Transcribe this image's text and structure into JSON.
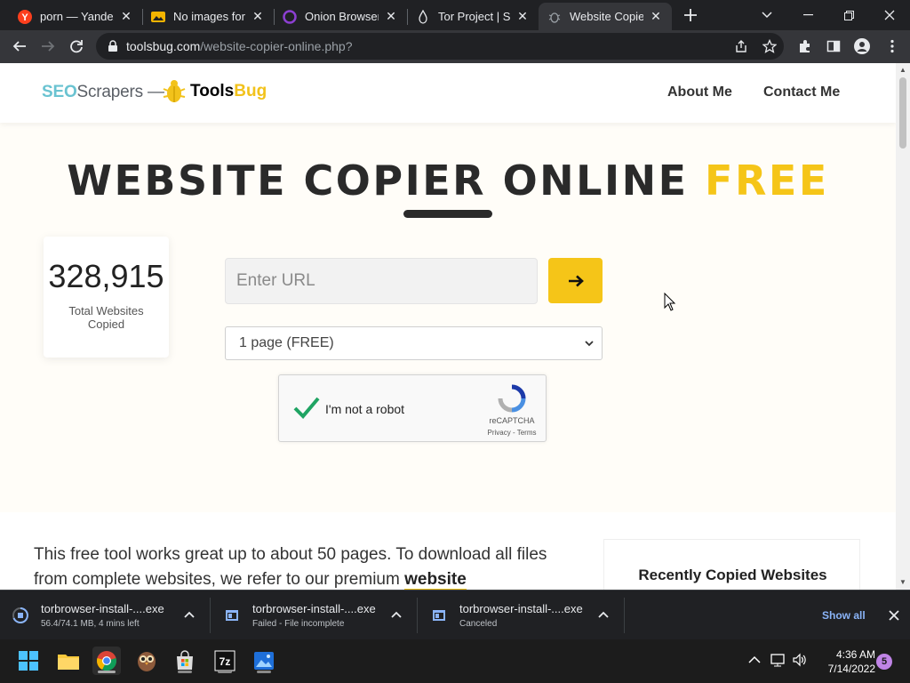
{
  "browser": {
    "tabs": [
      {
        "title": "porn — Yandex",
        "icon": "yandex-icon"
      },
      {
        "title": "No images for t",
        "icon": "image-icon"
      },
      {
        "title": "Onion Browser",
        "icon": "onion-icon"
      },
      {
        "title": "Tor Project | Sup",
        "icon": "tor-icon"
      },
      {
        "title": "Website Copier",
        "icon": "bug-icon"
      }
    ],
    "url_host": "toolsbug.com",
    "url_path": "/website-copier-online.php?"
  },
  "site": {
    "logo_seo": "SEO",
    "logo_scrapers": "Scrapers —",
    "logo_tools": "Tools",
    "logo_bug": "Bug",
    "nav": [
      "About Me",
      "Contact Me"
    ],
    "title_main": "WEBSITE COPIER ONLINE",
    "title_accent": "FREE",
    "counter_value": "328,915",
    "counter_label": "Total Websites Copied",
    "url_placeholder": "Enter URL",
    "page_option": "1 page (FREE)",
    "captcha_label": "I'm not a robot",
    "captcha_brand": "reCAPTCHA",
    "captcha_links": "Privacy - Terms",
    "intro_text": "This free tool works great up to about 50 pages. To download all files from complete websites, we refer to our premium",
    "intro_link": "website",
    "recent_title": "Recently Copied Websites"
  },
  "downloads": [
    {
      "name": "torbrowser-install-....exe",
      "status": "56.4/74.1 MB, 4 mins left"
    },
    {
      "name": "torbrowser-install-....exe",
      "status": "Failed - File incomplete"
    },
    {
      "name": "torbrowser-install-....exe",
      "status": "Canceled"
    }
  ],
  "downloads_show_all": "Show all",
  "taskbar": {
    "time": "4:36 AM",
    "date": "7/14/2022",
    "notifications": "5"
  },
  "colors": {
    "accent_yellow": "#f5c518",
    "seo_blue": "#6ac3d1",
    "chrome_dark": "#202124"
  }
}
